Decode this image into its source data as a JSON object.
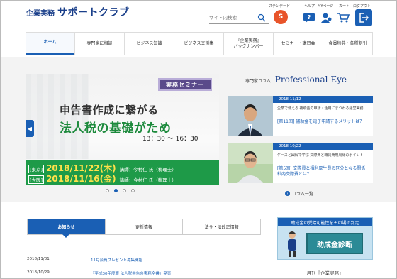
{
  "header": {
    "logo_prefix": "企業実務",
    "logo_main": "サポートクラブ",
    "search_placeholder": "サイト内検索",
    "steady_label": "ステンデード",
    "steady_badge": "S",
    "links": {
      "help": "ヘルプ",
      "mypage": "MYページ",
      "cart": "カート",
      "logout": "ログアウト"
    },
    "icons": [
      "search-icon",
      "help-icon",
      "user-icon",
      "cart-icon",
      "logout-icon"
    ]
  },
  "nav": {
    "items": [
      {
        "label": "ホーム",
        "active": true
      },
      {
        "label": "専門家に相談"
      },
      {
        "label": "ビジネス知識"
      },
      {
        "label": "ビジネス文例集"
      },
      {
        "label": "『企業実務』\nバックナンバー"
      },
      {
        "label": "セミナー・講習会"
      },
      {
        "label": "会員特典・各種割引"
      }
    ]
  },
  "banner": {
    "tag": "実務セミナー",
    "line1": "申告書作成に繋がる",
    "line2": "法人税の基礎がため",
    "time": "13：30 〜 16：30",
    "rows": [
      {
        "city": "[東京]",
        "date": "2018/11/22(木)",
        "lecturer": "講師：今村仁 氏（税理士）"
      },
      {
        "city": "[大阪]",
        "date": "2018/11/16(金)",
        "lecturer": "講師：今村仁 氏（税理士）"
      }
    ],
    "dots": 4,
    "active_dot": 1
  },
  "column": {
    "label_small": "専門家コラム",
    "label_big": "Professional Eye",
    "cards": [
      {
        "date": "2018 11/12",
        "sub": "企業で使える 補助金の申請・活用にまつわる経営実務",
        "title": "[第11回] 補助金を電子申請するメリットは？"
      },
      {
        "date": "2018 10/22",
        "sub": "ケースと図解で学ぶ 交際費と職員費用周縁のポイント",
        "title": "[第5回] 交際費と福利厚生費の区分となる関係　社内交際費とは？"
      }
    ],
    "more": "コラム一覧"
  },
  "tabs": [
    {
      "label": "お知らせ",
      "active": true
    },
    {
      "label": "更新情報"
    },
    {
      "label": "法令・法改正情報"
    }
  ],
  "news": [
    {
      "date": "2018/11/01",
      "text": "11月会員プレゼント募集開始"
    },
    {
      "date": "2018/10/29",
      "text": "『平成30年度版 法人税申告の実務全書』発売"
    }
  ],
  "promo": {
    "top": "助成金の受給可能性をその場で判定",
    "board": "助成金診断"
  },
  "monthly": "月刊『企業実務』",
  "colors": {
    "brand": "#1a5fb4",
    "banner_green": "#1e9a48",
    "accent_orange": "#e8542a",
    "date_yellow": "#ffe14a"
  }
}
